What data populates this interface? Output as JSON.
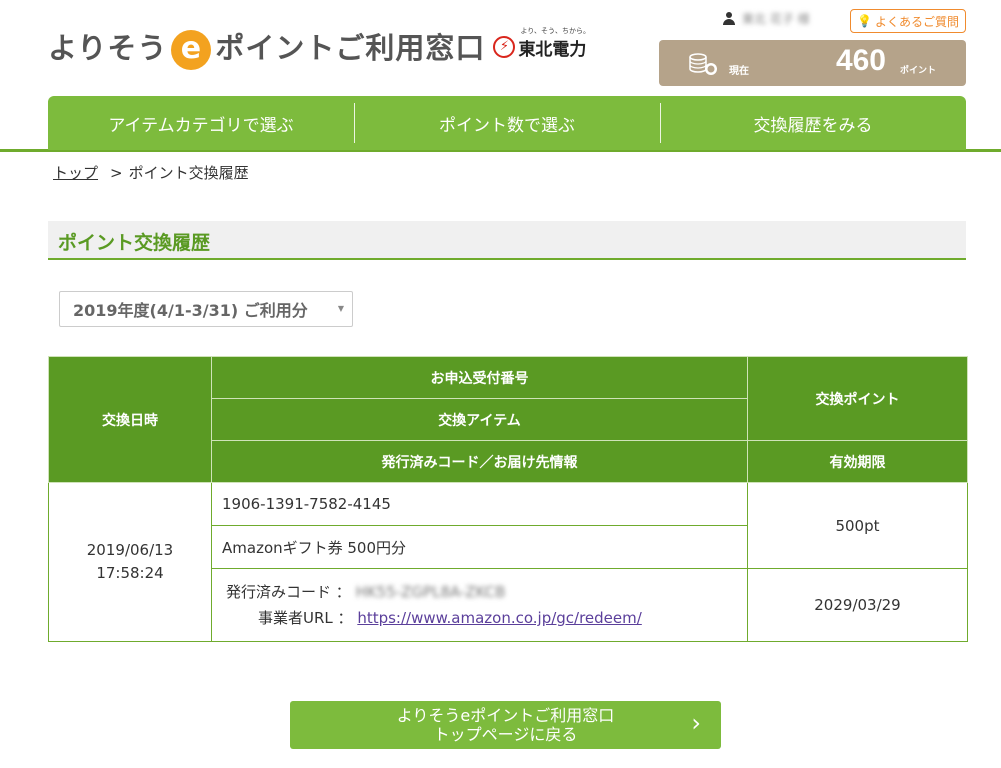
{
  "header": {
    "logo_prefix": "よりそう",
    "logo_e": "e",
    "logo_suffix": "ポイントご利用窓口",
    "company_tagline": "より、そう、ちから。",
    "company_name": "東北電力",
    "company_mark": "⚡",
    "user_name": "東北 花子 様",
    "faq_label": "よくあるご質問",
    "points_label": "現在",
    "points_value": "460",
    "points_unit": "ポイント"
  },
  "nav": {
    "items": [
      {
        "label": "アイテムカテゴリで選ぶ"
      },
      {
        "label": "ポイント数で選ぶ"
      },
      {
        "label": "交換履歴をみる"
      }
    ]
  },
  "breadcrumb": {
    "home": "トップ",
    "separator": ">",
    "current": "ポイント交換履歴"
  },
  "page_title": "ポイント交換履歴",
  "year_select": {
    "selected": "2019年度(4/1-3/31) ご利用分"
  },
  "table": {
    "headers": {
      "date": "交換日時",
      "order_no": "お申込受付番号",
      "item": "交換アイテム",
      "code_info": "発行済みコード／お届け先情報",
      "points": "交換ポイント",
      "expiry": "有効期限"
    },
    "rows": [
      {
        "date": "2019/06/13",
        "time": "17:58:24",
        "order_no": "1906-1391-7582-4145",
        "item": "Amazonギフト券 500円分",
        "points": "500pt",
        "code_label": "発行済みコード ：",
        "code_value": "HK55-ZGPL8A-ZKCB",
        "url_label": "事業者URL ：",
        "url": "https://www.amazon.co.jp/gc/redeem/",
        "expiry": "2029/03/29"
      }
    ]
  },
  "back_button": {
    "line1": "よりそうeポイントご利用窓口",
    "line2": "トップページに戻る"
  },
  "colors": {
    "brand_green": "#7dbb3d",
    "header_green": "#5a9a23",
    "accent_orange": "#f3a21f",
    "points_bg": "#b5a38a"
  }
}
